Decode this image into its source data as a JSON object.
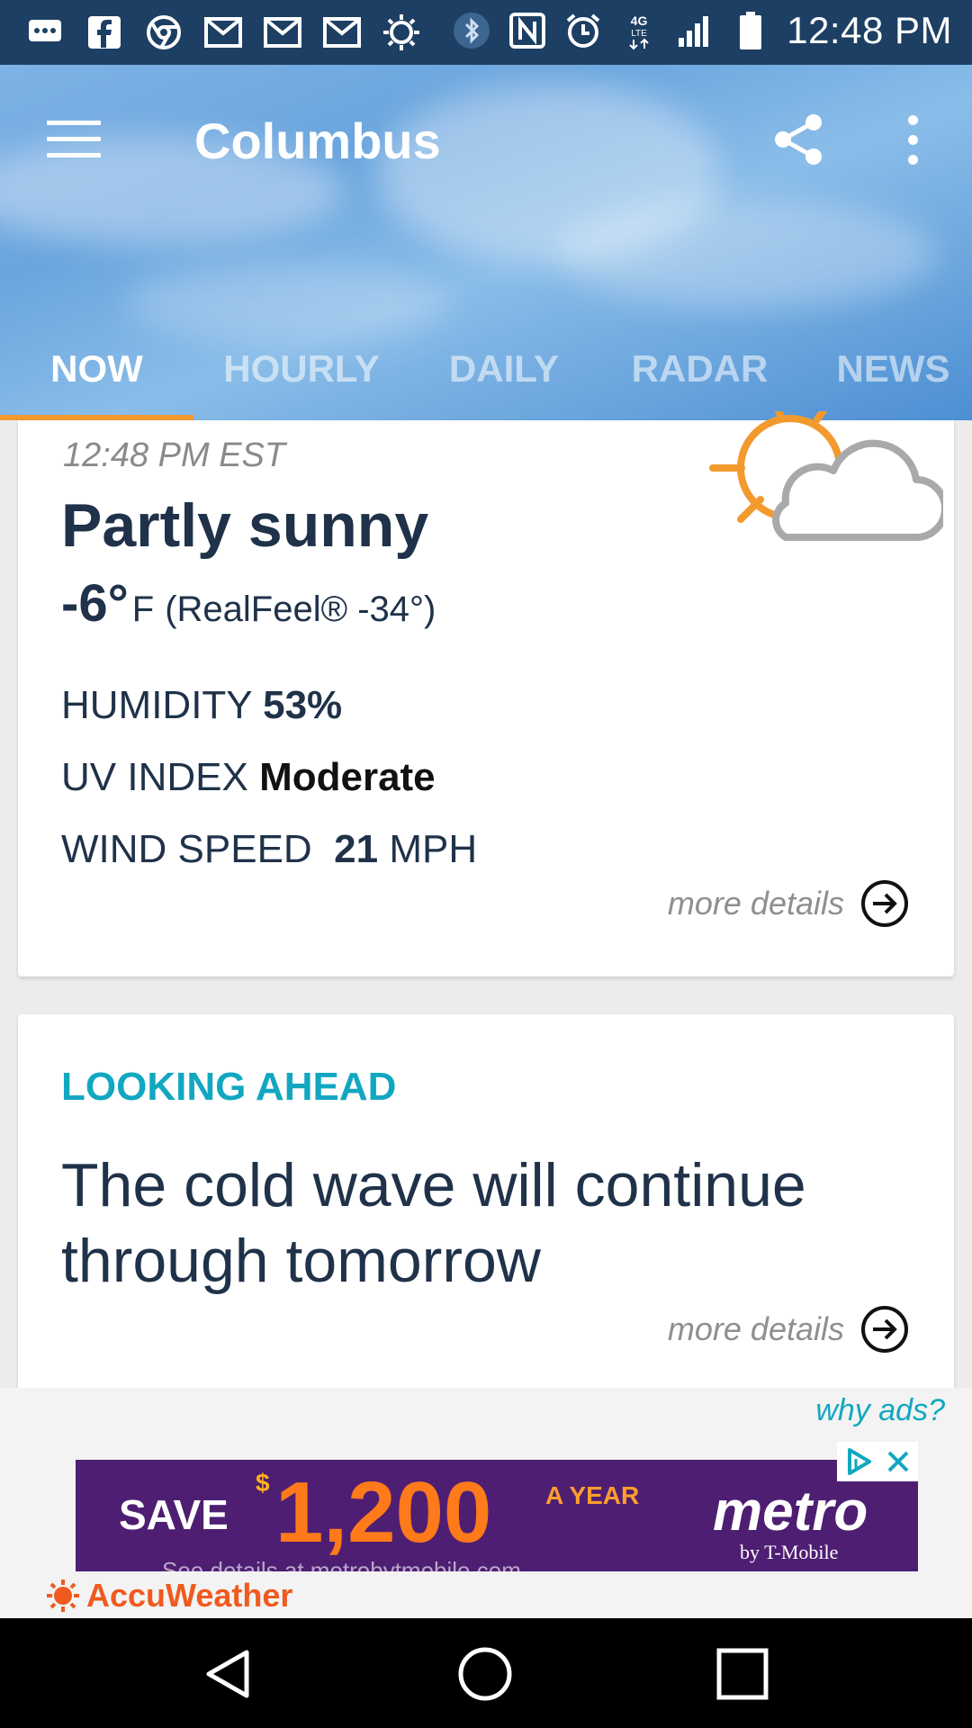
{
  "status_bar": {
    "time": "12:48 PM",
    "left_icons": [
      "chat-icon",
      "facebook-icon",
      "chrome-icon",
      "gmail-icon",
      "gmail-icon",
      "gmail-icon",
      "brightness-icon"
    ],
    "right_icons": [
      "bluetooth-icon",
      "nfc-icon",
      "alarm-icon",
      "4g-lte-icon",
      "signal-icon",
      "battery-icon"
    ],
    "network_label": "4G LTE"
  },
  "header": {
    "title": "Columbus",
    "tabs": [
      {
        "label": "NOW",
        "active": true
      },
      {
        "label": "HOURLY",
        "active": false
      },
      {
        "label": "DAILY",
        "active": false
      },
      {
        "label": "RADAR",
        "active": false
      },
      {
        "label": "NEWS",
        "active": false
      }
    ],
    "accent_color": "#f29a2e"
  },
  "current": {
    "time": "12:48 PM EST",
    "condition": "Partly sunny",
    "temp_value": "-6°",
    "temp_unit": "F",
    "realfeel": "(RealFeel® -34°)",
    "humidity_label": "HUMIDITY",
    "humidity_value": "53%",
    "uv_label": "UV INDEX",
    "uv_value": "Moderate",
    "wind_label": "WIND SPEED",
    "wind_value": "21",
    "wind_unit": "MPH",
    "more_details": "more details",
    "icon": "partly-sunny-icon"
  },
  "looking_ahead": {
    "section_title": "LOOKING AHEAD",
    "headline": "The cold wave will continue through tomorrow",
    "more_details": "more details",
    "accent_color": "#12a7c0"
  },
  "ad": {
    "why_ads": "why ads?",
    "save": "SAVE",
    "dollar": "$",
    "amount": "1,200",
    "period": "A YEAR",
    "brand": "metro",
    "brand_sub": "by T-Mobile",
    "fine_print": "See details at metrobytmobile.com",
    "provider": "AccuWeather"
  },
  "nav_bar": {
    "buttons": [
      "back-icon",
      "home-icon",
      "recents-icon"
    ]
  }
}
